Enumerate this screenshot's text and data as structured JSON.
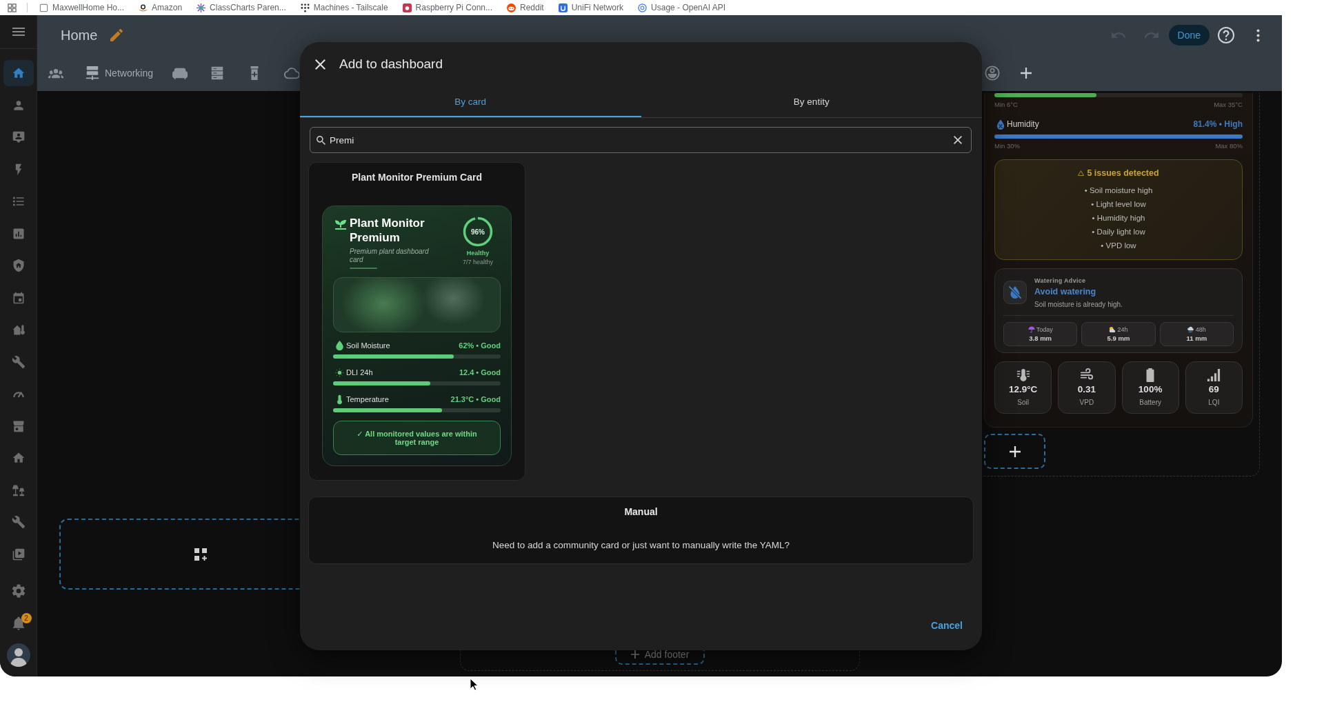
{
  "browser": {
    "bookmarks": [
      {
        "label": "MaxwellHome Ho..."
      },
      {
        "label": "Amazon"
      },
      {
        "label": "ClassCharts Paren..."
      },
      {
        "label": "Machines - Tailscale"
      },
      {
        "label": "Raspberry Pi Conn..."
      },
      {
        "label": "Reddit"
      },
      {
        "label": "UniFi Network"
      },
      {
        "label": "Usage - OpenAI API"
      }
    ]
  },
  "sidebar": {
    "items": [
      {
        "selected": true
      },
      {
        "selected": false
      },
      {
        "selected": false
      },
      {
        "selected": false
      },
      {
        "selected": false
      },
      {
        "selected": false
      },
      {
        "selected": false
      },
      {
        "selected": false
      },
      {
        "selected": false
      },
      {
        "selected": false
      },
      {
        "selected": false
      },
      {
        "selected": false
      },
      {
        "selected": false
      },
      {
        "selected": false
      },
      {
        "selected": false
      },
      {
        "selected": false
      }
    ],
    "settings": {
      "selected": false
    },
    "notifications": {
      "badge": "2"
    }
  },
  "header": {
    "title": "Home",
    "undo": {
      "disabled": true
    },
    "redo": {
      "disabled": true
    },
    "done": "Done"
  },
  "view_tabs": [
    {
      "selected": false
    },
    {
      "label": "Networking",
      "selected": false
    },
    {
      "selected": false
    },
    {
      "selected": false
    },
    {
      "selected": false
    },
    {
      "selected": false
    },
    {
      "selected": false
    }
  ],
  "dashboard": {
    "sensors": [
      {
        "level": 0.41,
        "color": "#4caf50",
        "min": "Min 6°C",
        "max": "Max 35°C"
      },
      {
        "label": "Humidity",
        "reading": "81.4% • High",
        "level": 1,
        "color": "#3b7ac4",
        "min": "Min 30%",
        "max": "Max 80%"
      }
    ],
    "issues": {
      "title": "5 issues detected",
      "items": [
        "• Soil moisture high",
        "• Light level low",
        "• Humidity high",
        "• Daily light low",
        "• VPD low"
      ]
    },
    "watering": {
      "label": "Watering Advice",
      "title": "Avoid watering",
      "detail": "Soil moisture is already high.",
      "forecast": [
        {
          "label": "Today",
          "value": "3.8 mm"
        },
        {
          "label": "24h",
          "value": "5.9 mm"
        },
        {
          "label": "48h",
          "value": "11 mm"
        }
      ]
    },
    "stats": [
      {
        "value": "12.9°C",
        "label": "Soil"
      },
      {
        "value": "0.31",
        "label": "VPD"
      },
      {
        "value": "100%",
        "label": "Battery"
      },
      {
        "value": "69",
        "label": "LQI"
      }
    ],
    "add_footer": "Add footer"
  },
  "dialog": {
    "title": "Add to dashboard",
    "tabs": [
      {
        "label": "By card",
        "selected": true
      },
      {
        "label": "By entity",
        "selected": false
      }
    ],
    "search": {
      "value": "Premi"
    },
    "results": [
      {
        "title": "Plant Monitor Premium Card",
        "preview": {
          "title": "Plant Monitor Premium",
          "subtitle": "Premium plant dashboard card",
          "health": {
            "level": 0.96,
            "value": "96%",
            "status": "Healthy",
            "detail": "7/7 healthy"
          },
          "metrics": [
            {
              "label": "Soil Moisture",
              "reading": "62% • Good",
              "level": 0.72
            },
            {
              "label": "DLI 24h",
              "reading": "12.4 • Good",
              "level": 0.58
            },
            {
              "label": "Temperature",
              "reading": "21.3°C • Good",
              "level": 0.65
            }
          ],
          "summary": "✓ All monitored values are within target range"
        }
      }
    ],
    "manual": {
      "title": "Manual",
      "description": "Need to add a community card or just want to manually write the YAML?"
    },
    "buttons": [
      "Cancel"
    ]
  }
}
